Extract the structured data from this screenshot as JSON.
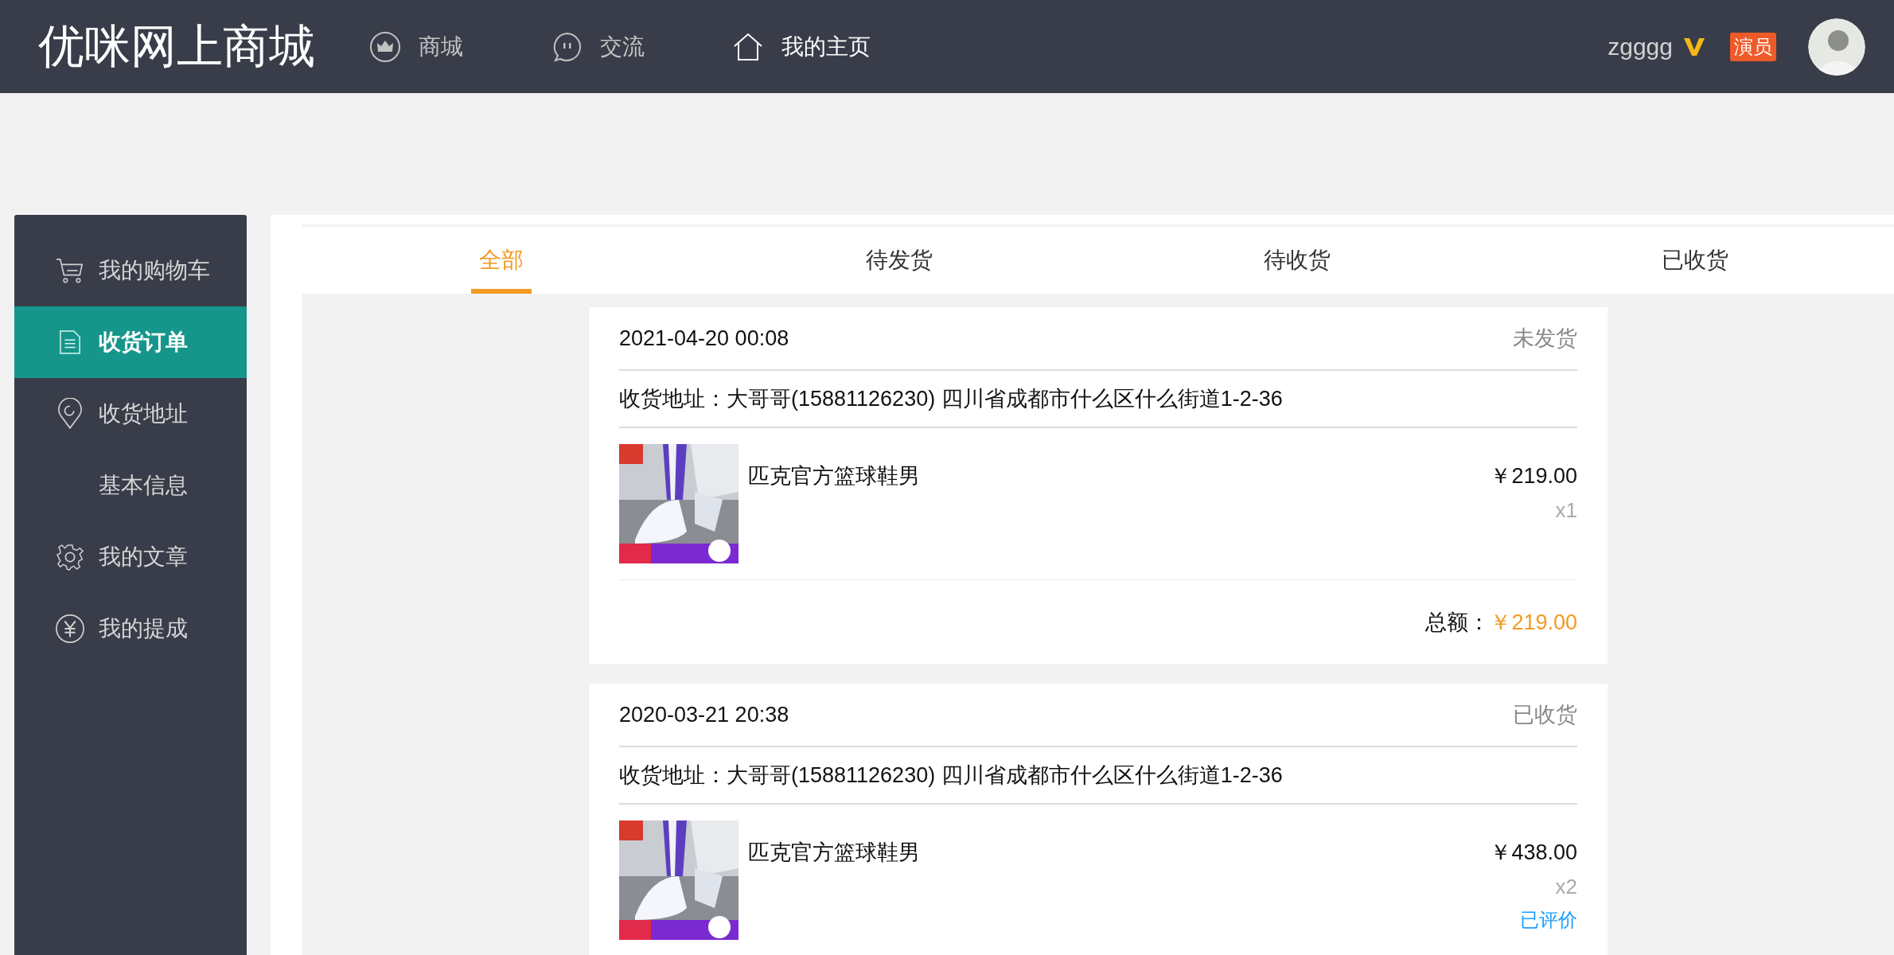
{
  "header": {
    "logo": "优咪网上商城",
    "nav": [
      {
        "label": "商城",
        "selected": false
      },
      {
        "label": "交流",
        "selected": false
      },
      {
        "label": "我的主页",
        "selected": true
      }
    ],
    "username": "zgggg",
    "role_badge": "演员"
  },
  "sidebar": {
    "items": [
      {
        "label": "我的购物车",
        "selected": false
      },
      {
        "label": "收货订单",
        "selected": true
      },
      {
        "label": "收货地址",
        "selected": false
      },
      {
        "label": "基本信息",
        "selected": false
      },
      {
        "label": "我的文章",
        "selected": false
      },
      {
        "label": "我的提成",
        "selected": false
      }
    ]
  },
  "tabs": [
    {
      "label": "全部",
      "selected": true
    },
    {
      "label": "待发货",
      "selected": false
    },
    {
      "label": "待收货",
      "selected": false
    },
    {
      "label": "已收货",
      "selected": false
    }
  ],
  "orders": [
    {
      "date": "2021-04-20 00:08",
      "status": "未发货",
      "address": "收货地址：大哥哥(15881126230) 四川省成都市什么区什么街道1-2-36",
      "items": [
        {
          "name": "匹克官方篮球鞋男",
          "price": "￥219.00",
          "quantity": "x1"
        }
      ],
      "total_label": "总额：",
      "total": "￥219.00"
    },
    {
      "date": "2020-03-21 20:38",
      "status": "已收货",
      "address": "收货地址：大哥哥(15881126230) 四川省成都市什么区什么街道1-2-36",
      "items": [
        {
          "name": "匹克官方篮球鞋男",
          "price": "￥438.00",
          "quantity": "x2",
          "review": "已评价"
        }
      ]
    }
  ]
}
